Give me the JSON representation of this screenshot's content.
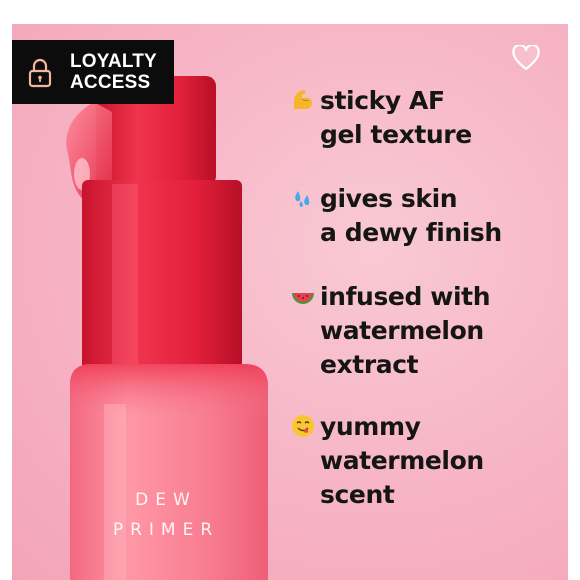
{
  "badge": {
    "line1": "LOYALTY",
    "line2": "ACCESS",
    "icon": "lock-icon"
  },
  "favorite": {
    "icon": "heart-outline-icon"
  },
  "product": {
    "label_line1": "DEW",
    "label_line2": "PRIMER"
  },
  "features": [
    {
      "emoji": "flexed-biceps",
      "lines": [
        "sticky AF",
        "gel texture"
      ]
    },
    {
      "emoji": "sweat-droplets",
      "lines": [
        "gives skin",
        "a dewy finish"
      ]
    },
    {
      "emoji": "watermelon",
      "lines": [
        "infused with",
        "watermelon",
        "extract"
      ]
    },
    {
      "emoji": "face-savoring-food",
      "lines": [
        "yummy",
        "watermelon",
        "scent"
      ]
    }
  ],
  "colors": {
    "background": "#f7b7c7",
    "bottle_red": "#e8243f",
    "bottle_pink": "#f77f92",
    "badge_bg": "#0c0c0c",
    "text": "#151515"
  }
}
